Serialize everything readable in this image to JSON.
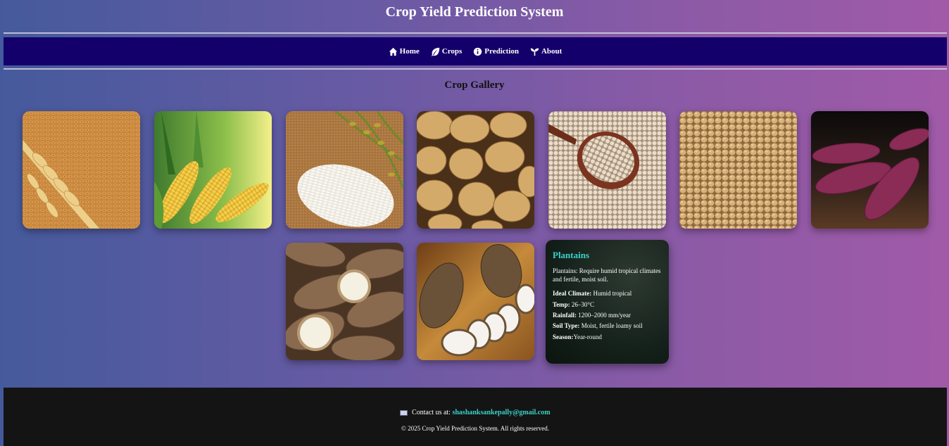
{
  "header": {
    "title": "Crop Yield Prediction System"
  },
  "nav": {
    "items": [
      {
        "label": "Home",
        "icon": "home-icon"
      },
      {
        "label": "Crops",
        "icon": "leaf-icon"
      },
      {
        "label": "Prediction",
        "icon": "info-icon"
      },
      {
        "label": "About",
        "icon": "seedling-icon"
      }
    ]
  },
  "gallery": {
    "title": "Crop Gallery",
    "crops": [
      {
        "name": "wheat"
      },
      {
        "name": "maize"
      },
      {
        "name": "rice"
      },
      {
        "name": "potato"
      },
      {
        "name": "millet"
      },
      {
        "name": "soybean"
      },
      {
        "name": "sweet-potato"
      },
      {
        "name": "cassava"
      },
      {
        "name": "yam"
      }
    ],
    "info_card": {
      "title": "Plantains",
      "description": "Plantains: Require humid tropical climates and fertile, moist soil.",
      "climate_label": "Ideal Climate:",
      "climate_value": " Humid tropical",
      "temp_label": "Temp:",
      "temp_value": " 26–30°C",
      "rainfall_label": "Rainfall:",
      "rainfall_value": " 1200–2000 mm/year",
      "soil_label": "Soil Type:",
      "soil_value": " Moist, fertile loamy soil",
      "season_label": "Season:",
      "season_value": "Year-round"
    }
  },
  "footer": {
    "contact_label": "Contact us at: ",
    "email": "shashanksankepally@gmail.com",
    "copyright": "© 2025 Crop Yield Prediction System. All rights reserved."
  },
  "colors": {
    "nav_bg": "#14006a",
    "accent": "#39d3c8",
    "footer_bg": "#141414"
  }
}
